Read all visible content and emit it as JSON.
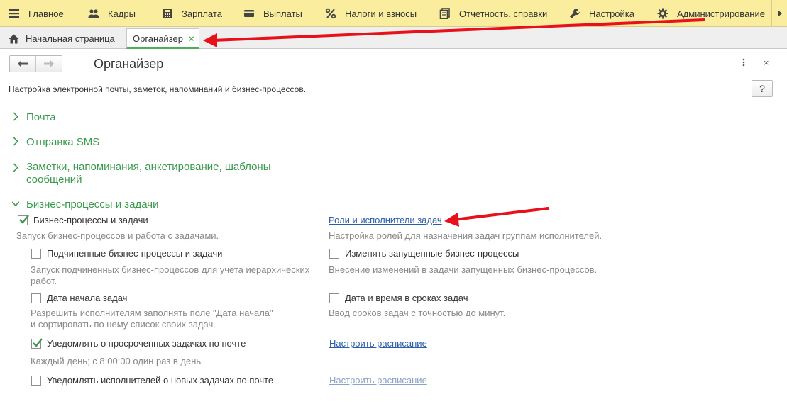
{
  "sections": [
    {
      "label": "Главное",
      "icon": "hamburger-menu-icon"
    },
    {
      "label": "Кадры",
      "icon": "people-icon"
    },
    {
      "label": "Зарплата",
      "icon": "calculator-icon"
    },
    {
      "label": "Выплаты",
      "icon": "wallet-icon"
    },
    {
      "label": "Налоги и взносы",
      "icon": "percent-icon"
    },
    {
      "label": "Отчетность, справки",
      "icon": "documents-icon"
    },
    {
      "label": "Настройка",
      "icon": "wrench-icon"
    },
    {
      "label": "Администрирование",
      "icon": "gear-icon"
    }
  ],
  "tabs": {
    "home": "Начальная страница",
    "active": "Органайзер",
    "close_symbol": "×"
  },
  "form": {
    "title": "Органайзер",
    "description": "Настройка электронной почты, заметок, напоминаний и бизнес-процессов.",
    "help": "?",
    "close": "×"
  },
  "groups": {
    "mail": "Почта",
    "sms": "Отправка SMS",
    "notes_line1": "Заметки, напоминания, анкетирование, шаблоны",
    "notes_line2": "сообщений",
    "bp": "Бизнес-процессы и задачи"
  },
  "settings": {
    "bp_enabled": {
      "label": "Бизнес-процессы и задачи",
      "checked": true,
      "hint": "Запуск бизнес-процессов и работа с задачами."
    },
    "subordinate": {
      "label": "Подчиненные бизнес-процессы и задачи",
      "checked": false,
      "hint_line1": "Запуск подчиненных бизнес-процессов для учета иерархических",
      "hint_line2": "работ."
    },
    "start_date": {
      "label": "Дата начала задач",
      "checked": false,
      "hint_line1": "Разрешить исполнителям заполнять поле \"Дата начала\"",
      "hint_line2": "и сортировать по нему список своих задач."
    },
    "overdue": {
      "label": "Уведомлять о просроченных задачах по почте",
      "checked": true,
      "hint": "Каждый день; с 8:00:00 один раз в день"
    },
    "new_tasks": {
      "label": "Уведомлять исполнителей о новых задачах по почте",
      "checked": false
    },
    "roles_link": "Роли и исполнители задач",
    "roles_hint": "Настройка ролей для назначения задач группам исполнителей.",
    "change_running": {
      "label": "Изменять запущенные бизнес-процессы",
      "checked": false,
      "hint": "Внесение изменений в задачи запущенных бизнес-процессов."
    },
    "datetime": {
      "label": "Дата и время в сроках задач",
      "checked": false,
      "hint": "Ввод сроков задач с точностью до минут."
    },
    "schedule_link_1": "Настроить расписание",
    "schedule_link_2": "Настроить расписание"
  },
  "colors": {
    "topbar": "#fbed9e",
    "group_green": "#3a9a4d",
    "link_blue": "#2b5ea8",
    "annotation_red": "#e8101a"
  }
}
